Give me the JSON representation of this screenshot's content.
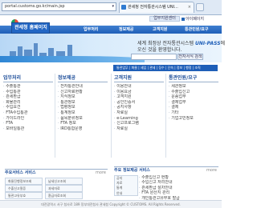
{
  "browser": {
    "address": "portal.customs.go.kr/main.jsp",
    "tab_title": "관세청 전자통관시스템 UNI...",
    "tab_close": "×"
  },
  "header": {
    "login_label": "업무지원센터",
    "site_label": "아이폐이지",
    "brand": "관세청 홈페이지",
    "menus": [
      "업무처리",
      "정보제공",
      "고객지원",
      "통관민원/요구"
    ]
  },
  "hero": {
    "slogan_line1_prefix": "세계 최정상 전자통관시스템",
    "slogan_line1_brand": "UNI-PASS",
    "slogan_line1_suffix": "에",
    "slogan_line2": "오신 것을 환영합니다.",
    "search_button": "전자서식 검색"
  },
  "subtabs": "통관업무 | 화물 | 세입 | 관세 | 징수 | 단속 | 정보 | 행정 | 조직",
  "columns": [
    {
      "title": "업무처리",
      "items": [
        "수출통관",
        "수입통관",
        "관세환급",
        "화물관리",
        "수입요건",
        "FTA수입통관",
        "가이드라인",
        "FTA",
        "모바일통관"
      ]
    },
    {
      "title": "정보제공",
      "items": [
        "전자통관안내",
        "신고자료현황",
        "지식정보",
        "통관정보",
        "법령정보",
        "통계정보",
        "품목분류정보",
        "FTA 정보",
        "IRD통합운영"
      ]
    },
    {
      "title": "고객지원",
      "items": [
        "이용안내",
        "이용요금",
        "고객지원",
        "공인인증서",
        "공지사항",
        "자료실",
        "e-Learning",
        "신고프로그램",
        "자료실"
      ]
    },
    {
      "title": "통관민원/요구",
      "items": [
        "세관정보",
        "수출입신고",
        "운송업무",
        "결제업무",
        "결제",
        "기타",
        "기업고민정보"
      ]
    }
  ],
  "bottom_left": {
    "title": "주요서비스 서비스",
    "more": "more",
    "rows": [
      [
        "화물진행정보조회",
        "납세신고조회"
      ],
      [
        "수출신고필증",
        "과세자료"
      ],
      [
        "통관고유부호",
        "환급자료조회"
      ],
      [
        "세관장확인대상",
        "수입신고필증"
      ]
    ]
  },
  "bottom_right": {
    "title": "주요 정보제공 서비스",
    "more": "more",
    "info": [
      "공지",
      "자료",
      "통계",
      "안내"
    ],
    "items": [
      "수출입신고 현황",
      "수입신고 처리안내",
      "관세환급 절차안내",
      "FTA 원산지 관리",
      "개인통관고유부호 발급",
      "공인인증서 안내",
      "세관 연락처"
    ]
  },
  "footer": "대전광역시 서구 청사로 189 정부대전청사 관세청 Copyright © CUSTOMS. All Rights Reserved."
}
